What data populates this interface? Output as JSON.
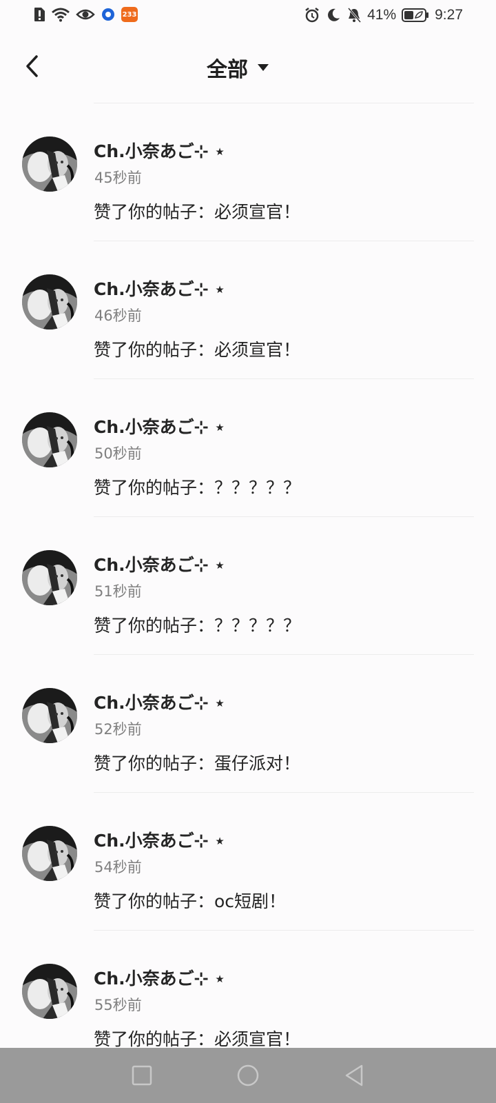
{
  "status_bar": {
    "battery_percent": "41%",
    "time": "9:27",
    "app_badge": "233",
    "icons": [
      "alert-sim-icon",
      "wifi-icon",
      "eye-icon",
      "circle-app-icon",
      "app-233-icon",
      "alarm-icon",
      "moon-icon",
      "bell-muted-icon",
      "battery-icon"
    ]
  },
  "header": {
    "title": "全部"
  },
  "notifications": [
    {
      "user": "Ch.小奈あご⊹ ⋆",
      "time": "45秒前",
      "message": "赞了你的帖子：必须宣官！"
    },
    {
      "user": "Ch.小奈あご⊹ ⋆",
      "time": "46秒前",
      "message": "赞了你的帖子：必须宣官！"
    },
    {
      "user": "Ch.小奈あご⊹ ⋆",
      "time": "50秒前",
      "message": "赞了你的帖子：？？？？？"
    },
    {
      "user": "Ch.小奈あご⊹ ⋆",
      "time": "51秒前",
      "message": "赞了你的帖子：？？？？？"
    },
    {
      "user": "Ch.小奈あご⊹ ⋆",
      "time": "52秒前",
      "message": "赞了你的帖子：蛋仔派对！"
    },
    {
      "user": "Ch.小奈あご⊹ ⋆",
      "time": "54秒前",
      "message": "赞了你的帖子：oc短剧！"
    },
    {
      "user": "Ch.小奈あご⊹ ⋆",
      "time": "55秒前",
      "message": "赞了你的帖子：必须宣官！"
    }
  ],
  "nav": {
    "buttons": [
      "recent-apps-icon",
      "home-icon",
      "back-triangle-icon"
    ]
  }
}
